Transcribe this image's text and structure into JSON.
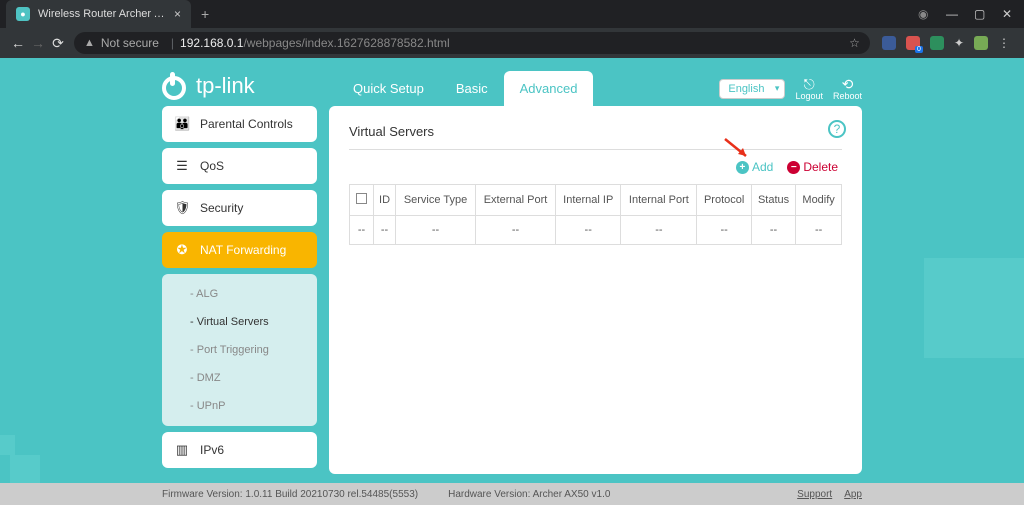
{
  "browser": {
    "tab_title": "Wireless Router Archer AX50",
    "security_label": "Not secure",
    "url_host": "192.168.0.1",
    "url_path": "/webpages/index.1627628878582.html"
  },
  "brand": "tp-link",
  "top_tabs": {
    "quick": "Quick Setup",
    "basic": "Basic",
    "advanced": "Advanced"
  },
  "language": "English",
  "sys": {
    "logout": "Logout",
    "reboot": "Reboot"
  },
  "sidebar": {
    "items": [
      {
        "label": "Parental Controls"
      },
      {
        "label": "QoS"
      },
      {
        "label": "Security"
      },
      {
        "label": "NAT Forwarding"
      },
      {
        "label": "IPv6"
      }
    ],
    "sub": [
      {
        "label": "ALG"
      },
      {
        "label": "Virtual Servers"
      },
      {
        "label": "Port Triggering"
      },
      {
        "label": "DMZ"
      },
      {
        "label": "UPnP"
      }
    ]
  },
  "content": {
    "title": "Virtual Servers",
    "add": "Add",
    "delete": "Delete",
    "columns": {
      "id": "ID",
      "service_type": "Service Type",
      "external_port": "External Port",
      "internal_ip": "Internal IP",
      "internal_port": "Internal Port",
      "protocol": "Protocol",
      "status": "Status",
      "modify": "Modify"
    },
    "empty": "--"
  },
  "footer": {
    "fw": "Firmware Version: 1.0.11 Build 20210730 rel.54485(5553)",
    "hw": "Hardware Version: Archer AX50 v1.0",
    "support": "Support",
    "app": "App"
  }
}
